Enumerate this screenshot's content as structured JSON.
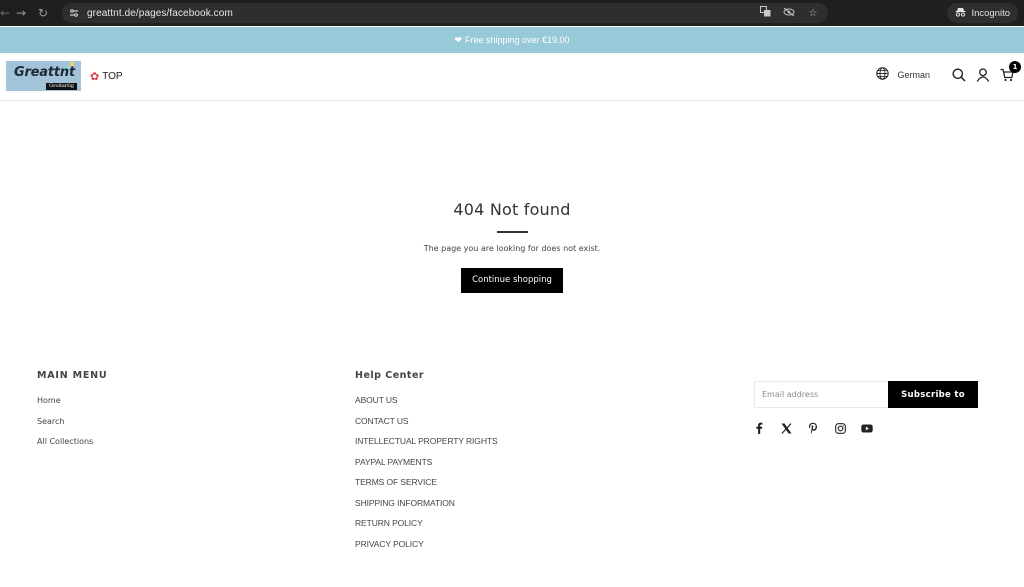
{
  "browser": {
    "url": "greattnt.de/pages/facebook.com",
    "incognito_label": "Incognito",
    "icons": [
      "back-arrow-icon",
      "forward-arrow-icon",
      "reload-icon",
      "site-info-icon",
      "translate-icon",
      "eye-off-icon",
      "star-icon",
      "incognito-icon"
    ]
  },
  "announcement": {
    "icon": "heart-icon",
    "text": "Free shipping over €19.00"
  },
  "header": {
    "logo_text": "Greattnt",
    "logo_subtext": "Großartig",
    "top_link": "TOP",
    "language": "German",
    "cart_count": "1"
  },
  "main": {
    "title": "404 Not found",
    "message": "The page you are looking for does not exist.",
    "button_label": "Continue shopping"
  },
  "footer": {
    "main_menu": {
      "title": "MAIN MENU",
      "items": [
        "Home",
        "Search",
        "All Collections"
      ]
    },
    "help_center": {
      "title": "Help Center",
      "items": [
        "ABOUT US",
        "CONTACT US",
        "INTELLECTUAL PROPERTY RIGHTS",
        "PAYPAL PAYMENTS",
        "TERMS OF SERVICE",
        "SHIPPING INFORMATION",
        "RETURN POLICY",
        "PRIVACY POLICY"
      ]
    },
    "newsletter": {
      "placeholder": "Email address",
      "button_label": "Subscribe to"
    },
    "social": [
      "facebook-icon",
      "x-twitter-icon",
      "pinterest-icon",
      "instagram-icon",
      "youtube-icon"
    ]
  },
  "colors": {
    "announcement_bg": "#98c9d8",
    "button_bg": "#000000",
    "logo_bg": "#a3c3d9"
  }
}
